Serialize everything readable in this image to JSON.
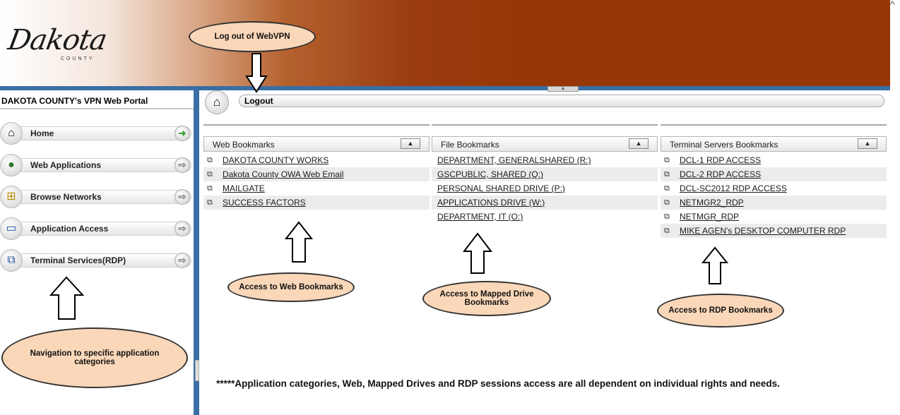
{
  "header": {
    "logo_text": "Dakota",
    "logo_subtext": "COUNTY",
    "close_glyph": "^"
  },
  "sidebar": {
    "title": "DAKOTA COUNTY's VPN Web Portal",
    "items": [
      {
        "label": "Home",
        "icon": "home-icon",
        "glyph": "⌂",
        "arrow": "➜"
      },
      {
        "label": "Web Applications",
        "icon": "globe-icon",
        "glyph": "●",
        "arrow": "⇨"
      },
      {
        "label": "Browse Networks",
        "icon": "network-icon",
        "glyph": "⊞",
        "arrow": "⇨"
      },
      {
        "label": "Application Access",
        "icon": "monitor-icon",
        "glyph": "▭",
        "arrow": "⇨"
      },
      {
        "label": "Terminal Services(RDP)",
        "icon": "rdp-icon",
        "glyph": "⧉",
        "arrow": "⇨"
      }
    ]
  },
  "toolbar": {
    "home_glyph": "⌂",
    "logout_label": "Logout"
  },
  "columns": {
    "web": {
      "title": "Web Bookmarks",
      "collapse_glyph": "▲",
      "links": [
        "DAKOTA COUNTY WORKS",
        "Dakota County OWA Web Email",
        "MAILGATE",
        "SUCCESS FACTORS"
      ]
    },
    "file": {
      "title": "File Bookmarks",
      "collapse_glyph": "▲",
      "links": [
        "DEPARTMENT, GENERALSHARED (R:)",
        "GSCPUBLIC, SHARED (Q:)",
        "PERSONAL SHARED DRIVE (P:)",
        "APPLICATIONS DRIVE (W:)",
        "DEPARTMENT, IT (O:)"
      ]
    },
    "terminal": {
      "title": "Terminal Servers Bookmarks",
      "collapse_glyph": "▲",
      "links": [
        "DCL-1 RDP ACCESS",
        "DCL-2 RDP ACCESS",
        "DCL-SC2012 RDP ACCESS",
        "NETMGR2_RDP",
        "NETMGR_RDP",
        "MIKE AGEN's DESKTOP COMPUTER RDP"
      ]
    },
    "link_glyph": "⧉"
  },
  "callouts": {
    "logout": "Log out of WebVPN",
    "navigation": "Navigation to specific application categories",
    "web": "Access to Web Bookmarks",
    "mapped": "Access to Mapped Drive Bookmarks",
    "rdp": "Access to RDP Bookmarks"
  },
  "footer_note": "*****Application categories, Web, Mapped Drives and RDP sessions access are all dependent on individual rights and needs.",
  "colors": {
    "header_brown": "#963606",
    "frame_blue": "#3a6ea5",
    "callout_fill": "#fad7b8"
  }
}
